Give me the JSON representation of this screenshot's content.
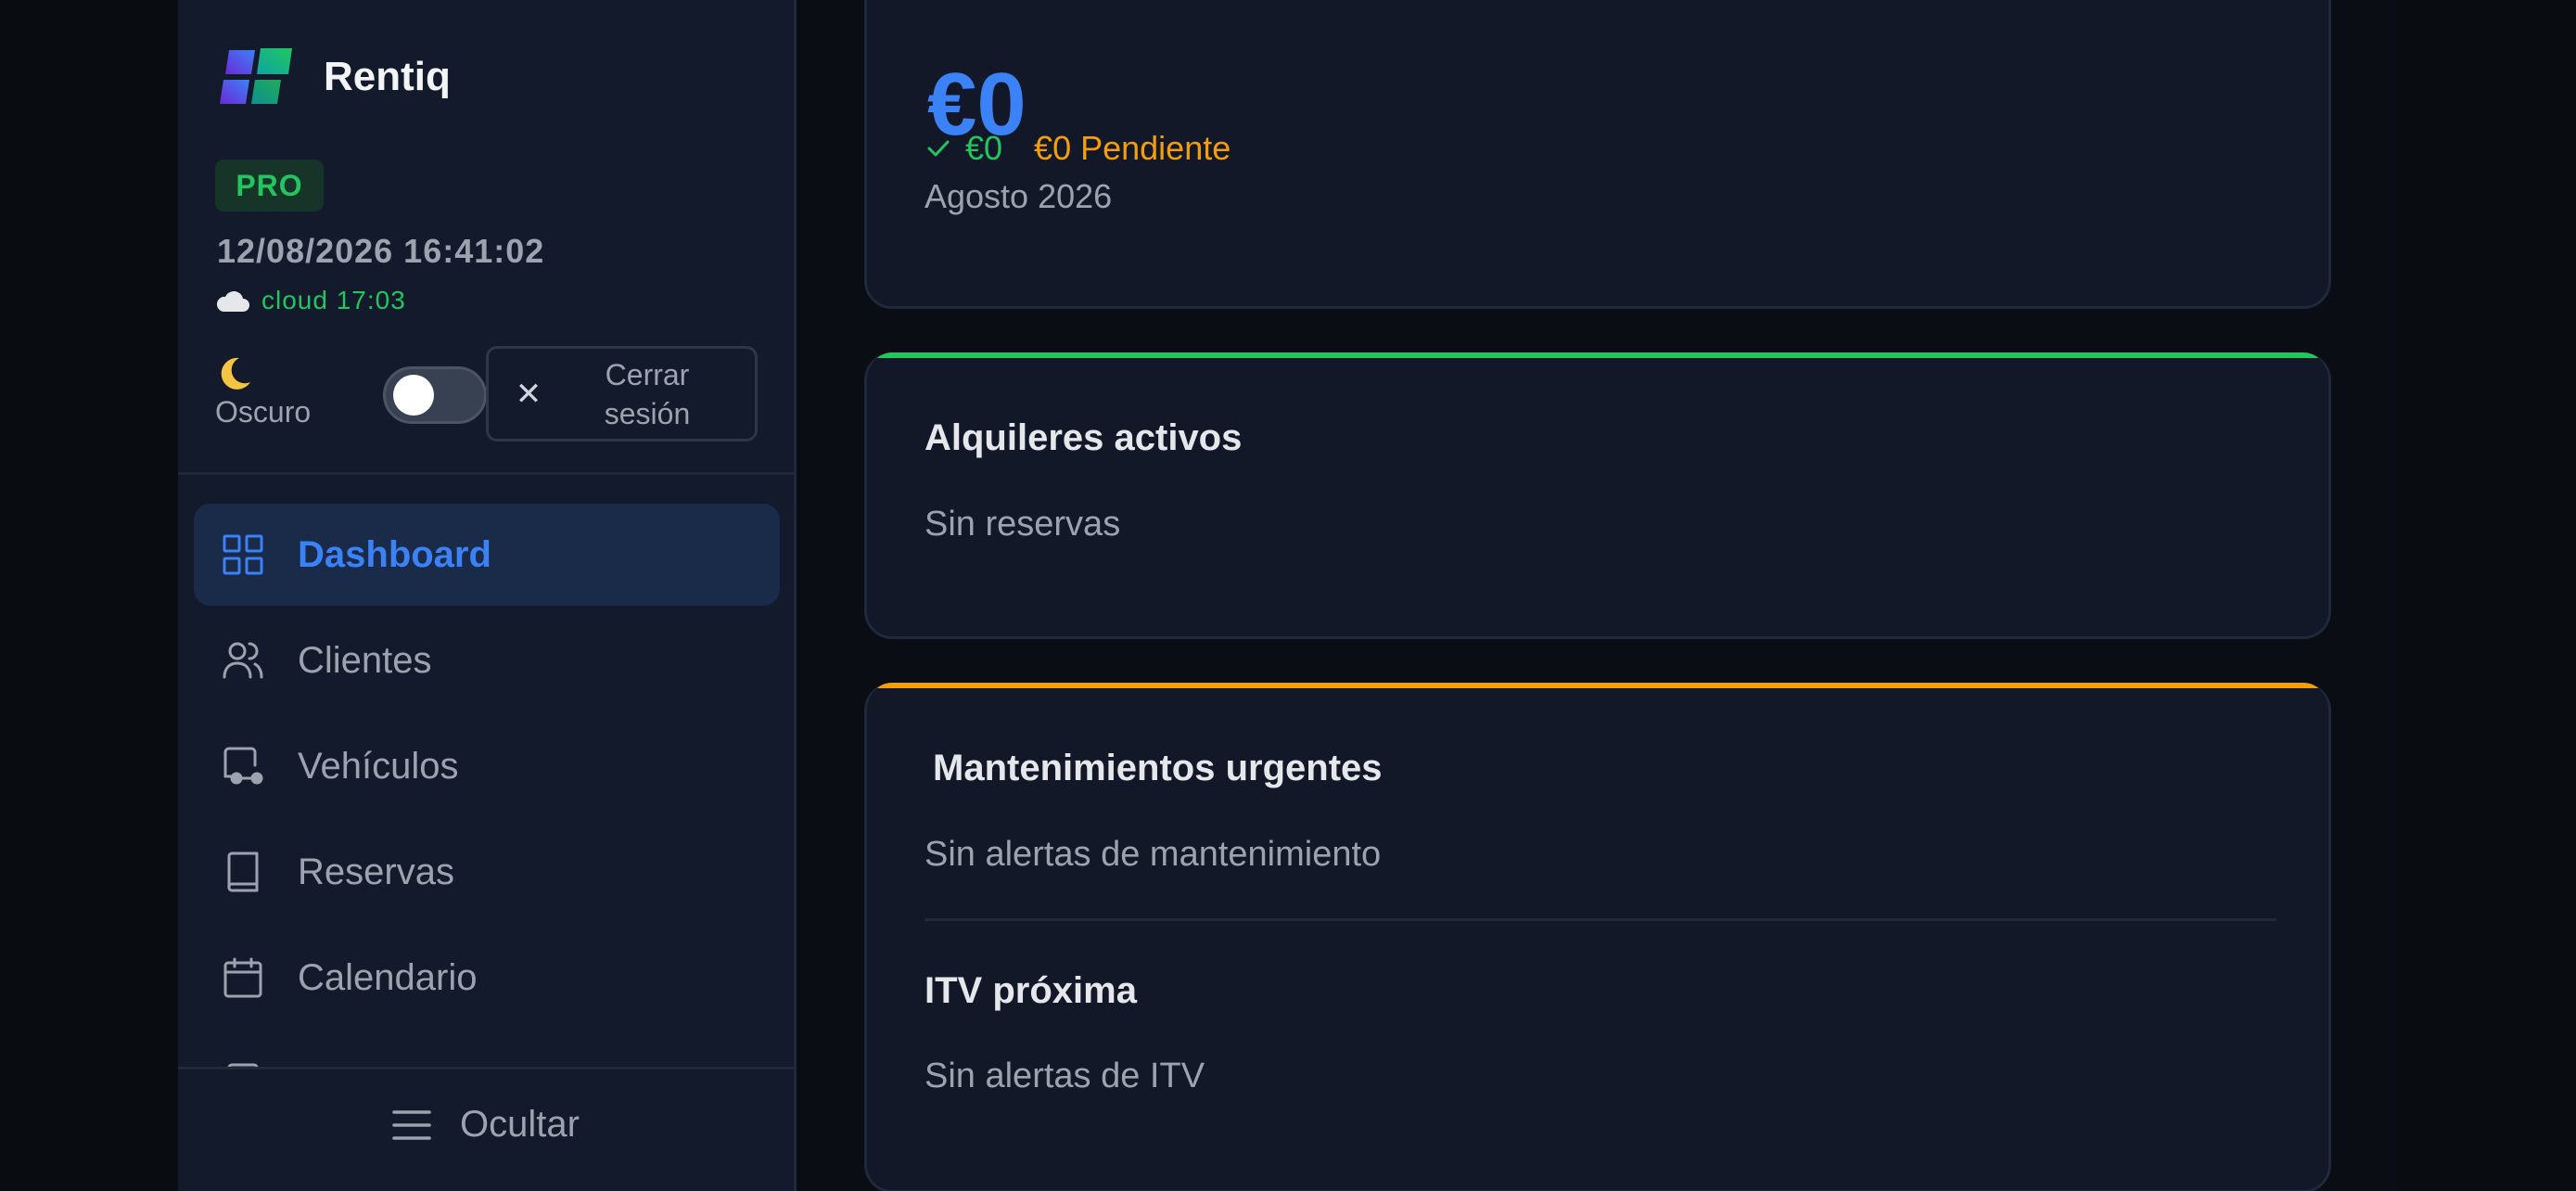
{
  "colors": {
    "accent_blue": "#3b82f6",
    "success_green": "#22c55e",
    "warning_amber": "#f59e0b",
    "sidebar_bg": "#131a2b",
    "card_bg": "#121828"
  },
  "brand": {
    "name": "Rentiq",
    "logo_icon": "rentiq-logo"
  },
  "plan_badge": "PRO",
  "datetime": "12/08/2026 16:41:02",
  "cloud_status": {
    "icon": "cloud-icon",
    "text": "cloud 17:03"
  },
  "theme": {
    "icon": "moon-icon",
    "label": "Oscuro",
    "dark_mode": false
  },
  "logout": {
    "icon": "close-icon",
    "label": "Cerrar sesión"
  },
  "nav": {
    "items": [
      {
        "label": "Dashboard",
        "icon": "grid-icon",
        "active": true
      },
      {
        "label": "Clientes",
        "icon": "users-icon",
        "active": false
      },
      {
        "label": "Vehículos",
        "icon": "car-icon",
        "active": false
      },
      {
        "label": "Reservas",
        "icon": "book-icon",
        "active": false
      },
      {
        "label": "Calendario",
        "icon": "calendar-icon",
        "active": false
      }
    ]
  },
  "sidebar_footer": {
    "icon": "menu-icon",
    "label": "Ocultar"
  },
  "revenue": {
    "amount": "€0",
    "paid": "€0",
    "pending": "€0 Pendiente",
    "period": "Agosto 2026"
  },
  "active_rentals": {
    "title": "Alquileres activos",
    "empty_text": "Sin reservas"
  },
  "maintenance": {
    "title": "Mantenimientos urgentes",
    "empty_text": "Sin alertas de mantenimiento",
    "itv_title": "ITV próxima",
    "itv_empty_text": "Sin alertas de ITV"
  }
}
